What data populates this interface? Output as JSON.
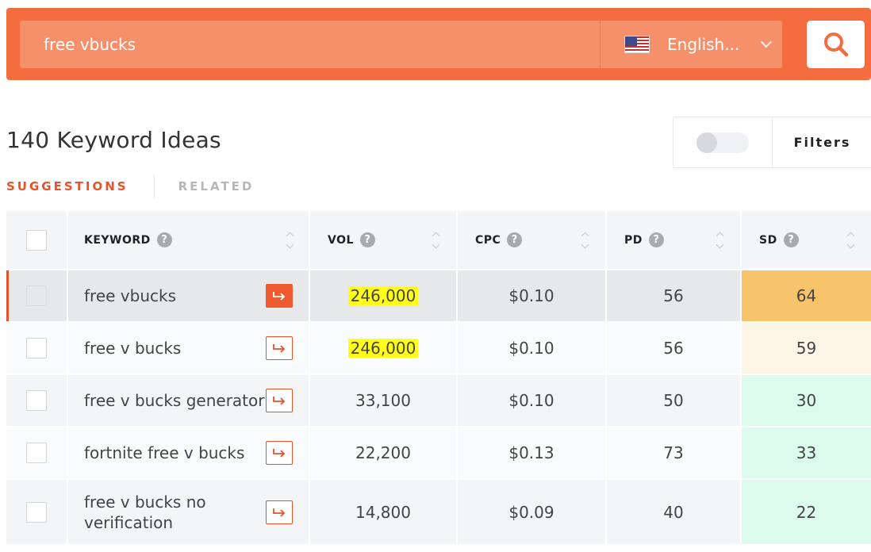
{
  "search": {
    "query": "free vbucks",
    "language": "English...",
    "flag_icon": "us-flag-icon",
    "button_icon": "search-icon"
  },
  "header": {
    "title": "140 Keyword Ideas",
    "filters_label": "Filters",
    "toggle_on": false
  },
  "tabs": [
    {
      "label": "SUGGESTIONS",
      "active": true
    },
    {
      "label": "RELATED",
      "active": false
    }
  ],
  "columns": {
    "keyword": "KEYWORD",
    "vol": "VOL",
    "cpc": "CPC",
    "pd": "PD",
    "sd": "SD"
  },
  "rows": [
    {
      "keyword": "free vbucks",
      "vol": "246,000",
      "cpc": "$0.10",
      "pd": "56",
      "sd": "64"
    },
    {
      "keyword": "free v bucks",
      "vol": "246,000",
      "cpc": "$0.10",
      "pd": "56",
      "sd": "59"
    },
    {
      "keyword": "free v bucks generator",
      "vol": "33,100",
      "cpc": "$0.10",
      "pd": "50",
      "sd": "30"
    },
    {
      "keyword": "fortnite free v bucks",
      "vol": "22,200",
      "cpc": "$0.13",
      "pd": "73",
      "sd": "33"
    },
    {
      "keyword": "free v bucks no verification",
      "vol": "14,800",
      "cpc": "$0.09",
      "pd": "40",
      "sd": "22"
    }
  ],
  "colors": {
    "brand": "#f36d3f",
    "active_tab": "#e5532b",
    "highlight": "#ffff1a",
    "sd_high": "#f8c46b",
    "sd_mid": "#fdf6e6",
    "sd_low": "#ddfaee"
  }
}
